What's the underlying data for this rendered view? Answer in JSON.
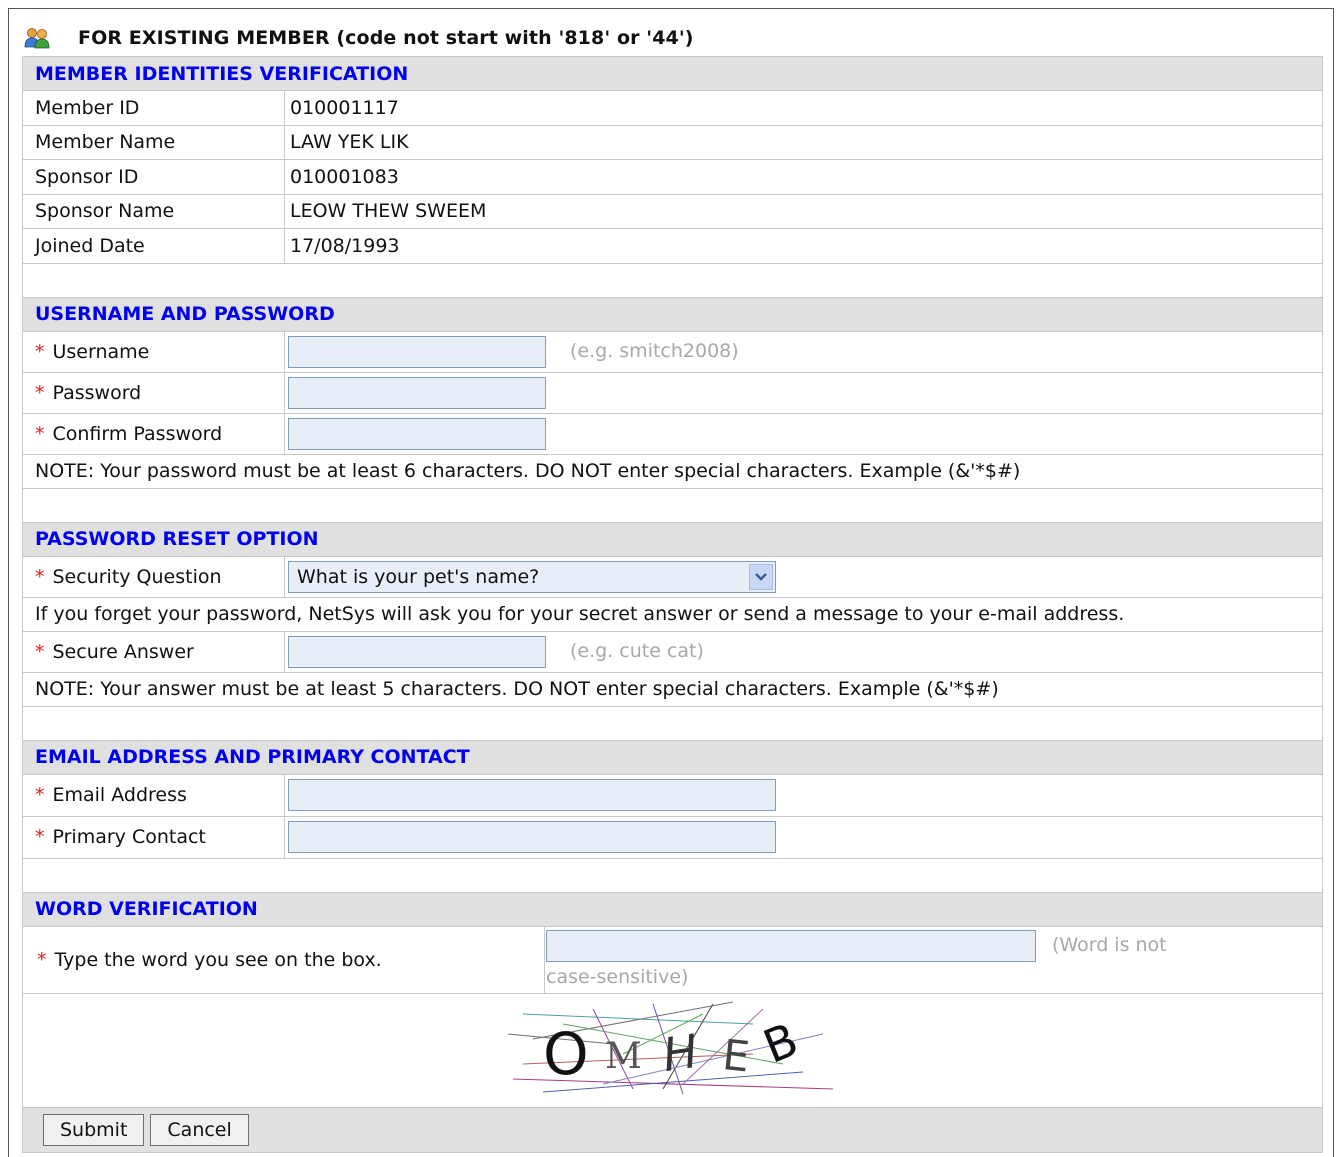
{
  "page": {
    "title": "FOR EXISTING MEMBER (code not start with '818' or '44')",
    "icon": "users-icon"
  },
  "sections": {
    "identity": {
      "heading": "MEMBER IDENTITIES VERIFICATION",
      "rows": [
        {
          "label": "Member ID",
          "value": "010001117"
        },
        {
          "label": "Member Name",
          "value": "LAW YEK LIK"
        },
        {
          "label": "Sponsor ID",
          "value": "010001083"
        },
        {
          "label": "Sponsor Name",
          "value": "LEOW THEW SWEEM"
        },
        {
          "label": "Joined Date",
          "value": "17/08/1993"
        }
      ]
    },
    "credentials": {
      "heading": "USERNAME AND PASSWORD",
      "username_label": "Username",
      "username_value": "",
      "username_hint": "(e.g. smitch2008)",
      "password_label": "Password",
      "password_value": "",
      "confirm_label": "Confirm Password",
      "confirm_value": "",
      "note": "NOTE: Your password must be at least 6 characters. DO NOT enter special characters. Example (&'*$#)"
    },
    "reset": {
      "heading": "PASSWORD RESET OPTION",
      "question_label": "Security Question",
      "question_selected": "What is your pet's name?",
      "info": "If you forget your password, NetSys will ask you for your secret answer or send a message to your e-mail address.",
      "answer_label": "Secure Answer",
      "answer_value": "",
      "answer_hint": "(e.g. cute cat)",
      "note": "NOTE: Your answer must be at least 5 characters. DO NOT enter special characters. Example (&'*$#)"
    },
    "contact": {
      "heading": "EMAIL ADDRESS AND PRIMARY CONTACT",
      "email_label": "Email Address",
      "email_value": "",
      "phone_label": "Primary Contact",
      "phone_value": ""
    },
    "verify": {
      "heading": "WORD VERIFICATION",
      "prompt_label": "Type the word you see on the box.",
      "word_value": "",
      "hint_line1": "(Word is not",
      "hint_line2": "case-sensitive)",
      "captcha_letters": [
        "O",
        "M",
        "H",
        "E",
        "B"
      ]
    }
  },
  "required_marker": "*",
  "buttons": {
    "submit": "Submit",
    "cancel": "Cancel"
  },
  "colors": {
    "heading": "#0000ee",
    "required": "#e02020",
    "input_bg": "#e8eef7",
    "section_bg": "#e0e0e0",
    "hint": "#a8a8a8"
  }
}
